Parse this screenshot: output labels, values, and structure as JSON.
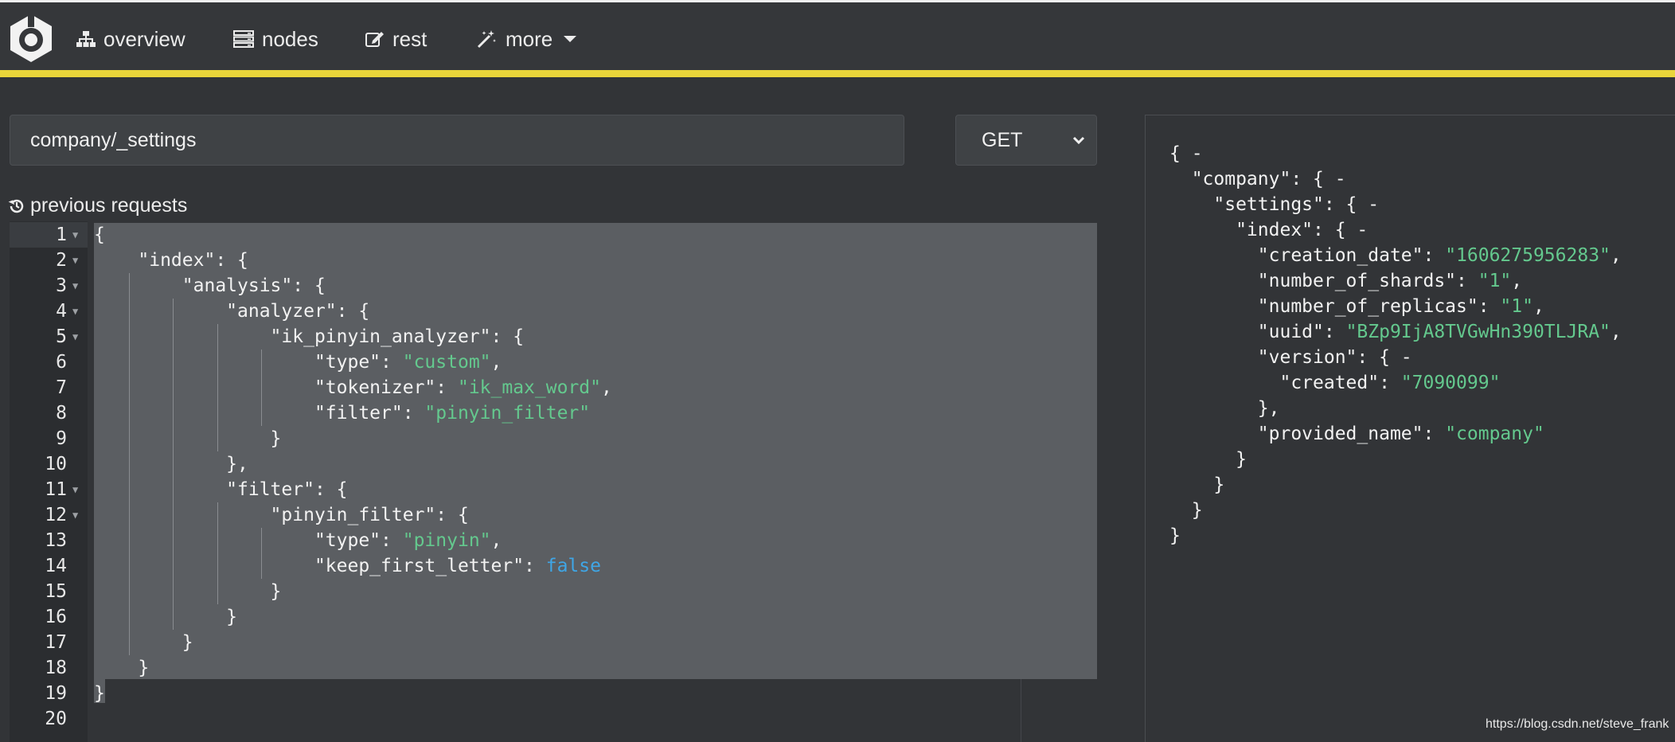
{
  "nav": {
    "items": [
      {
        "label": "overview",
        "icon": "sitemap-icon"
      },
      {
        "label": "nodes",
        "icon": "server-icon"
      },
      {
        "label": "rest",
        "icon": "edit-icon"
      },
      {
        "label": "more",
        "icon": "magic-wand-icon"
      }
    ]
  },
  "request": {
    "url": "company/_settings",
    "method": "GET",
    "previous_requests_label": "previous requests"
  },
  "editor": {
    "line_numbers": [
      "1",
      "2",
      "3",
      "4",
      "5",
      "6",
      "7",
      "8",
      "9",
      "10",
      "11",
      "12",
      "13",
      "14",
      "15",
      "16",
      "17",
      "18",
      "19",
      "20"
    ],
    "lines": [
      [
        {
          "t": "{",
          "c": ""
        }
      ],
      [
        {
          "t": "    \"index\": {",
          "c": ""
        }
      ],
      [
        {
          "t": "        \"analysis\": {",
          "c": ""
        }
      ],
      [
        {
          "t": "            \"analyzer\": {",
          "c": ""
        }
      ],
      [
        {
          "t": "                \"ik_pinyin_analyzer\": {",
          "c": ""
        }
      ],
      [
        {
          "t": "                    \"type\": ",
          "c": ""
        },
        {
          "t": "\"custom\"",
          "c": "str"
        },
        {
          "t": ",",
          "c": ""
        }
      ],
      [
        {
          "t": "                    \"tokenizer\": ",
          "c": ""
        },
        {
          "t": "\"ik_max_word\"",
          "c": "str"
        },
        {
          "t": ",",
          "c": ""
        }
      ],
      [
        {
          "t": "                    \"filter\": ",
          "c": ""
        },
        {
          "t": "\"pinyin_filter\"",
          "c": "str"
        }
      ],
      [
        {
          "t": "                }",
          "c": ""
        }
      ],
      [
        {
          "t": "            },",
          "c": ""
        }
      ],
      [
        {
          "t": "            \"filter\": {",
          "c": ""
        }
      ],
      [
        {
          "t": "                \"pinyin_filter\": {",
          "c": ""
        }
      ],
      [
        {
          "t": "                    \"type\": ",
          "c": ""
        },
        {
          "t": "\"pinyin\"",
          "c": "str"
        },
        {
          "t": ",",
          "c": ""
        }
      ],
      [
        {
          "t": "                    \"keep_first_letter\": ",
          "c": ""
        },
        {
          "t": "false",
          "c": "bool"
        }
      ],
      [
        {
          "t": "                }",
          "c": ""
        }
      ],
      [
        {
          "t": "            }",
          "c": ""
        }
      ],
      [
        {
          "t": "        }",
          "c": ""
        }
      ],
      [
        {
          "t": "    }",
          "c": ""
        }
      ],
      [
        {
          "t": "}",
          "c": ""
        }
      ],
      [
        {
          "t": "",
          "c": ""
        }
      ]
    ]
  },
  "response": {
    "lines": [
      [
        {
          "t": "{ -",
          "c": ""
        }
      ],
      [
        {
          "t": "  \"company\": { -",
          "c": ""
        }
      ],
      [
        {
          "t": "    \"settings\": { -",
          "c": ""
        }
      ],
      [
        {
          "t": "      \"index\": { -",
          "c": ""
        }
      ],
      [
        {
          "t": "        \"creation_date\": ",
          "c": ""
        },
        {
          "t": "\"1606275956283\"",
          "c": "str"
        },
        {
          "t": ",",
          "c": ""
        }
      ],
      [
        {
          "t": "        \"number_of_shards\": ",
          "c": ""
        },
        {
          "t": "\"1\"",
          "c": "str"
        },
        {
          "t": ",",
          "c": ""
        }
      ],
      [
        {
          "t": "        \"number_of_replicas\": ",
          "c": ""
        },
        {
          "t": "\"1\"",
          "c": "str"
        },
        {
          "t": ",",
          "c": ""
        }
      ],
      [
        {
          "t": "        \"uuid\": ",
          "c": ""
        },
        {
          "t": "\"BZp9IjA8TVGwHn390TLJRA\"",
          "c": "str"
        },
        {
          "t": ",",
          "c": ""
        }
      ],
      [
        {
          "t": "        \"version\": { -",
          "c": ""
        }
      ],
      [
        {
          "t": "          \"created\": ",
          "c": ""
        },
        {
          "t": "\"7090099\"",
          "c": "str"
        }
      ],
      [
        {
          "t": "        },",
          "c": ""
        }
      ],
      [
        {
          "t": "        \"provided_name\": ",
          "c": ""
        },
        {
          "t": "\"company\"",
          "c": "str"
        }
      ],
      [
        {
          "t": "      }",
          "c": ""
        }
      ],
      [
        {
          "t": "    }",
          "c": ""
        }
      ],
      [
        {
          "t": "  }",
          "c": ""
        }
      ],
      [
        {
          "t": "}",
          "c": ""
        }
      ]
    ]
  },
  "watermark": "https://blog.csdn.net/steve_frank",
  "colors": {
    "accent": "#e9d53a",
    "string": "#64c98e",
    "boolean": "#3fa6e6",
    "background": "#323437"
  }
}
